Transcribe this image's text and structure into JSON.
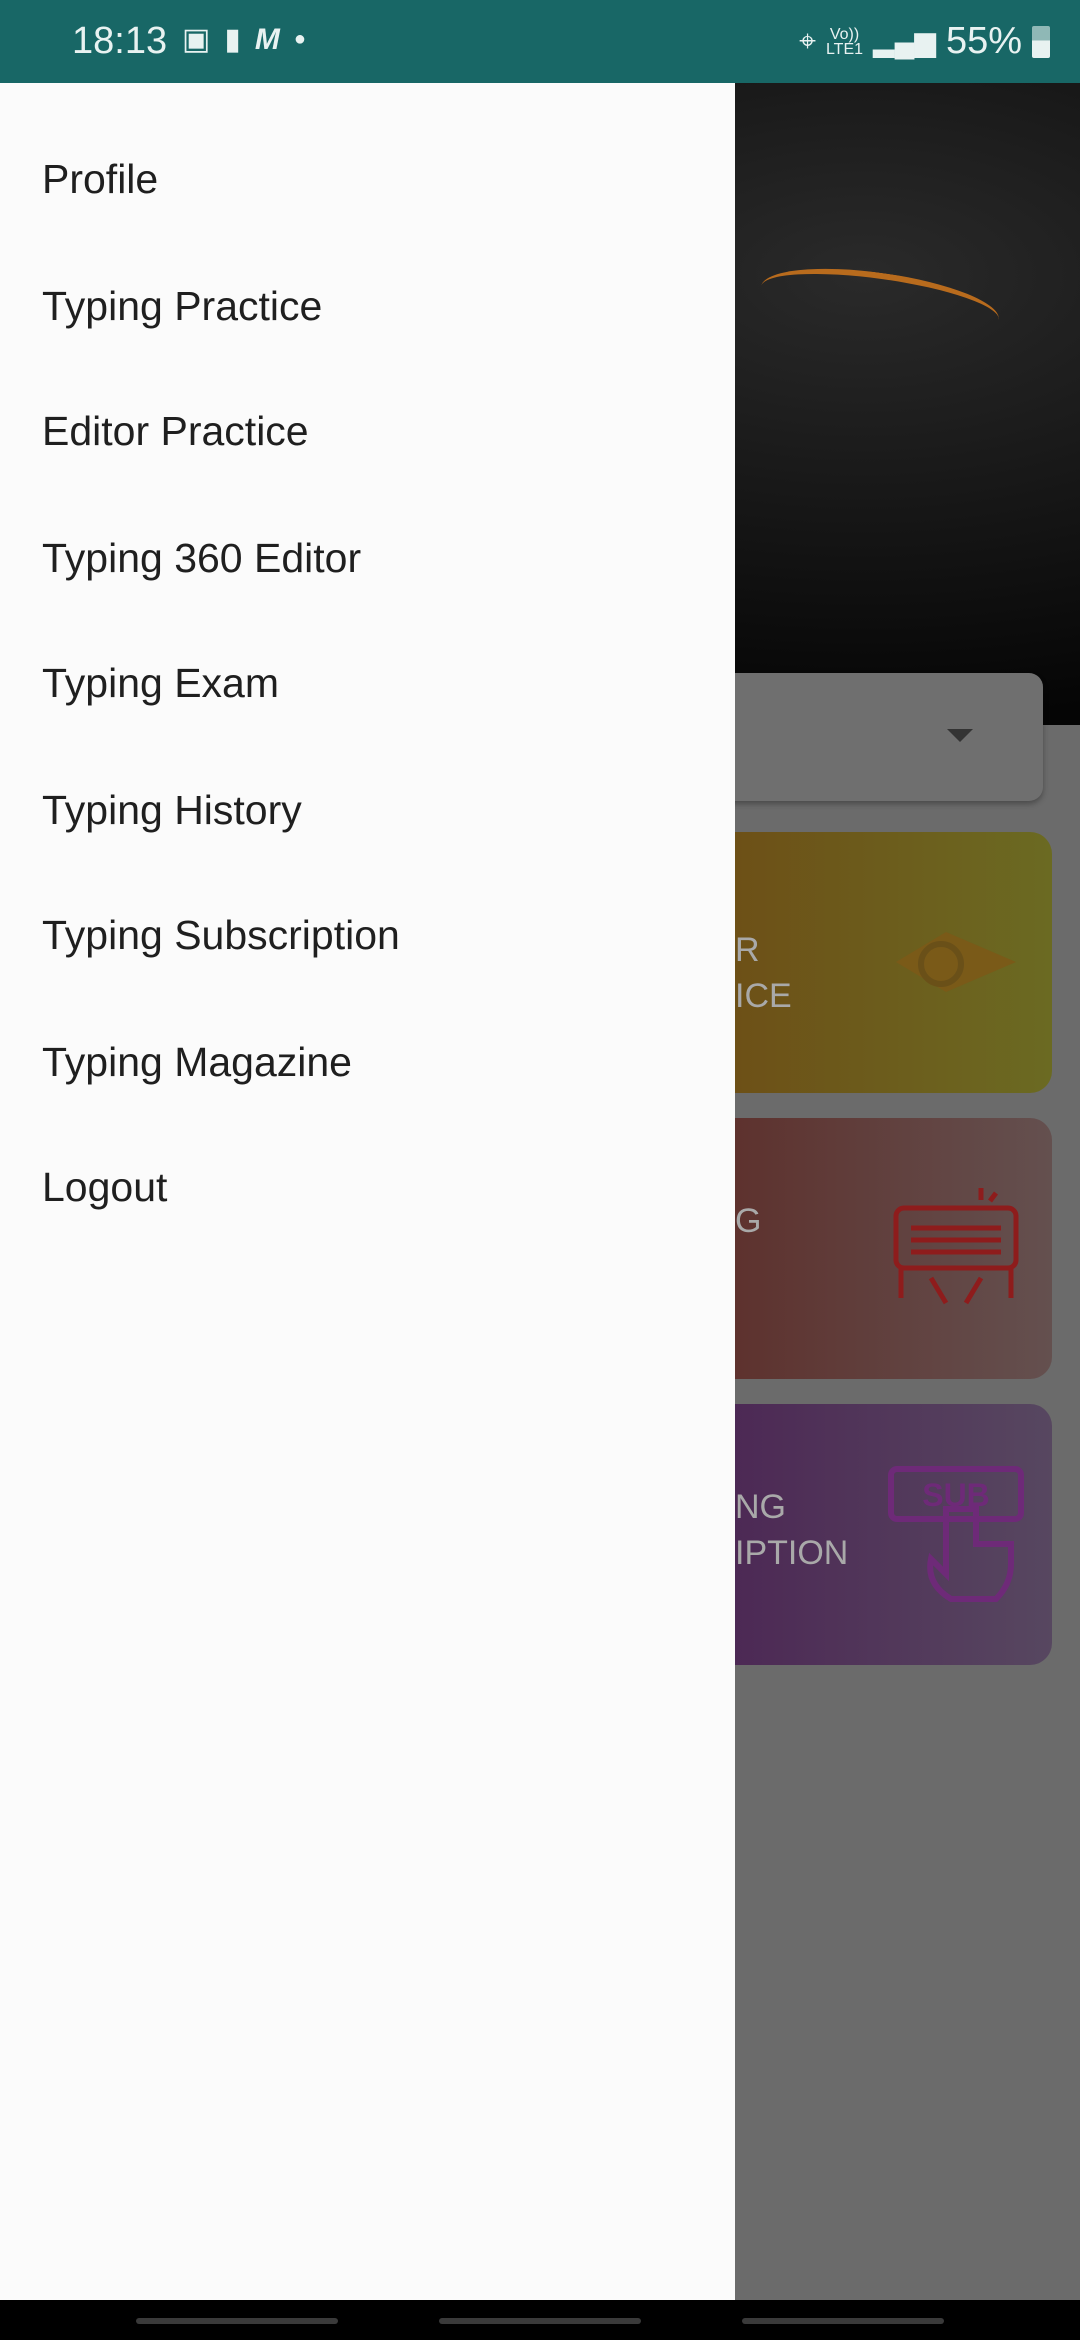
{
  "status_bar": {
    "time": "18:13",
    "icons": [
      "image-icon",
      "message-icon",
      "m-app-icon",
      "dot-icon"
    ],
    "right_icons": [
      "wifi-icon",
      "volte-icon",
      "signal-icon",
      "battery-icon"
    ],
    "volte_top": "Vo))",
    "volte_bottom": "LTE1",
    "battery": "55%"
  },
  "drawer": {
    "items": [
      {
        "label": "Profile"
      },
      {
        "label": "Typing Practice"
      },
      {
        "label": "Editor Practice"
      },
      {
        "label": "Typing 360 Editor"
      },
      {
        "label": "Typing Exam"
      },
      {
        "label": "Typing History"
      },
      {
        "label": "Typing Subscription"
      },
      {
        "label": "Typing Magazine"
      },
      {
        "label": "Logout"
      }
    ]
  },
  "background": {
    "cards": [
      {
        "line1": "R",
        "line2": "ICE",
        "icon": "pencil-icon",
        "color": "#f0a020"
      },
      {
        "line1": "G",
        "line2": "",
        "icon": "keyboard-typing-icon",
        "color": "#c0392b"
      },
      {
        "line1": "NG",
        "line2": "IPTION",
        "icon": "subscribe-click-icon",
        "icon_text": "SUB",
        "color": "#8e2a9e"
      }
    ]
  },
  "colors": {
    "status_bar": "#186766",
    "drawer": "#fbfbfb"
  }
}
